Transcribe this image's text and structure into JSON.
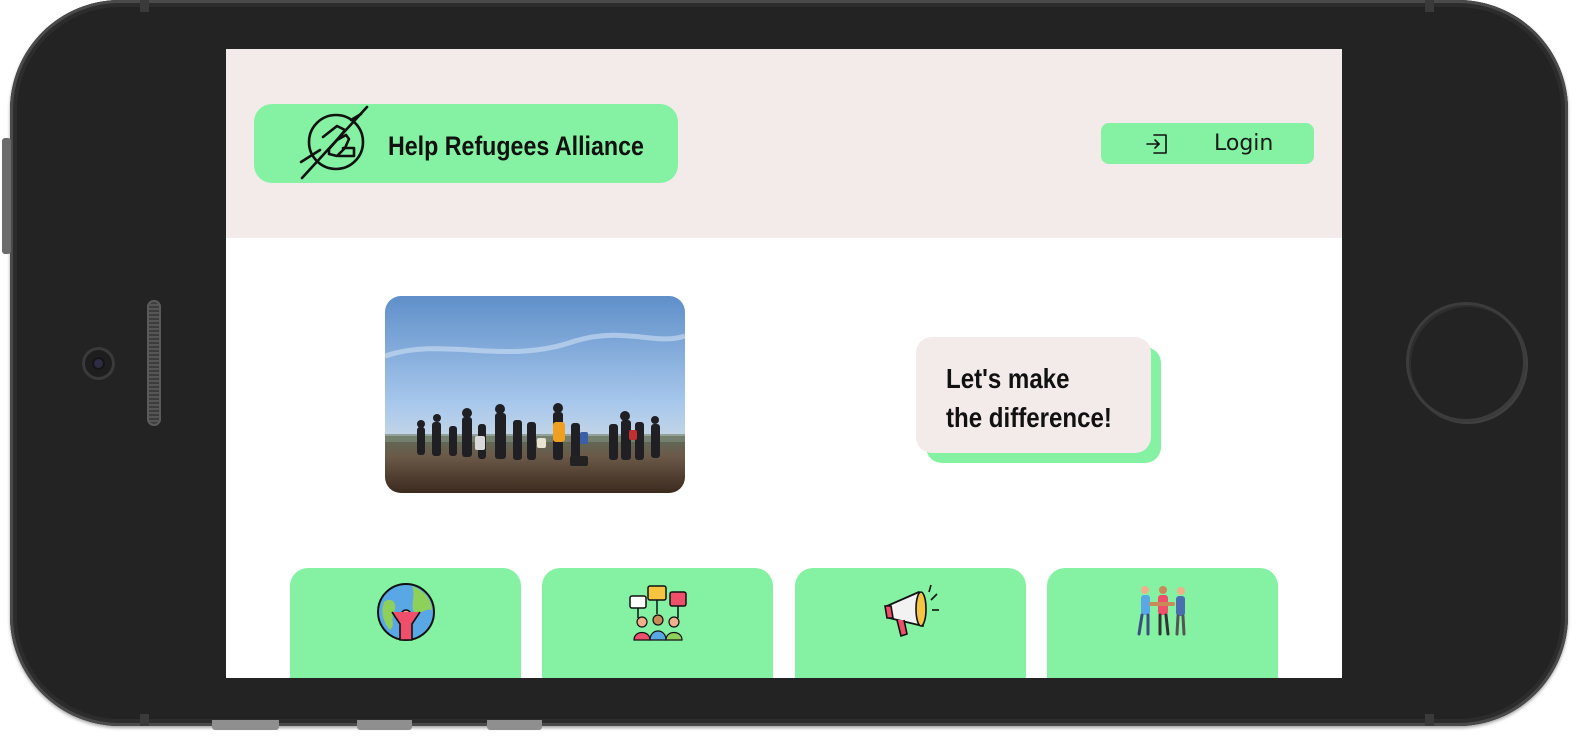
{
  "app": {
    "name": "Help Refugees Alliance",
    "logo_icon": "hands-helping-icon"
  },
  "header": {
    "login_label": "Login",
    "login_icon": "sign-in-icon"
  },
  "hero": {
    "image": "refugees-walking-field-photo",
    "slogan_line1": "Let's make",
    "slogan_line2": "the difference!"
  },
  "cards": [
    {
      "icon": "globe-person-icon"
    },
    {
      "icon": "protest-crowd-icon"
    },
    {
      "icon": "megaphone-icon"
    },
    {
      "icon": "people-handshake-icon"
    }
  ],
  "colors": {
    "accent_green": "#84f2a2",
    "header_background": "#f3eaea",
    "device_frame": "#232323"
  }
}
